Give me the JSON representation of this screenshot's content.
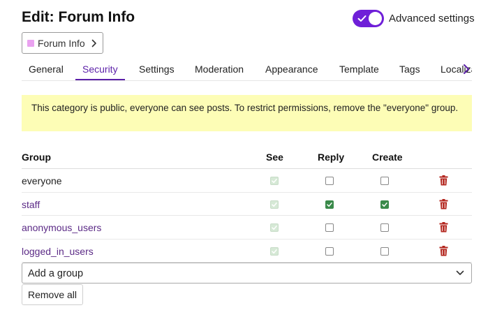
{
  "header": {
    "title": "Edit: Forum Info",
    "advanced_label": "Advanced settings",
    "advanced_enabled": true,
    "toggle_color": "#6f1fd8"
  },
  "breadcrumb": {
    "label": "Forum Info",
    "swatch_color": "#eaa2f0"
  },
  "tabs": [
    {
      "label": "General",
      "active": false
    },
    {
      "label": "Security",
      "active": true
    },
    {
      "label": "Settings",
      "active": false
    },
    {
      "label": "Moderation",
      "active": false
    },
    {
      "label": "Appearance",
      "active": false
    },
    {
      "label": "Template",
      "active": false
    },
    {
      "label": "Tags",
      "active": false
    },
    {
      "label": "Localization",
      "active": false
    }
  ],
  "notice": {
    "text": "This category is public, everyone can see posts. To restrict permissions, remove the \"everyone\" group."
  },
  "table": {
    "columns": {
      "group": "Group",
      "see": "See",
      "reply": "Reply",
      "create": "Create"
    },
    "rows": [
      {
        "group": "everyone",
        "link": false,
        "see": true,
        "reply": false,
        "create": false
      },
      {
        "group": "staff",
        "link": true,
        "see": true,
        "reply": true,
        "create": true
      },
      {
        "group": "anonymous_users",
        "link": true,
        "see": true,
        "reply": false,
        "create": false
      },
      {
        "group": "logged_in_users",
        "link": true,
        "see": true,
        "reply": false,
        "create": false
      }
    ]
  },
  "add_group": {
    "label": "Add a group"
  },
  "remove_all": {
    "label": "Remove all"
  },
  "colors": {
    "accent": "#5b1fa8",
    "link": "#5b2a86",
    "notice_bg": "#fdfdb6",
    "checked": "#3a8a4a",
    "delete": "#b3261e"
  }
}
